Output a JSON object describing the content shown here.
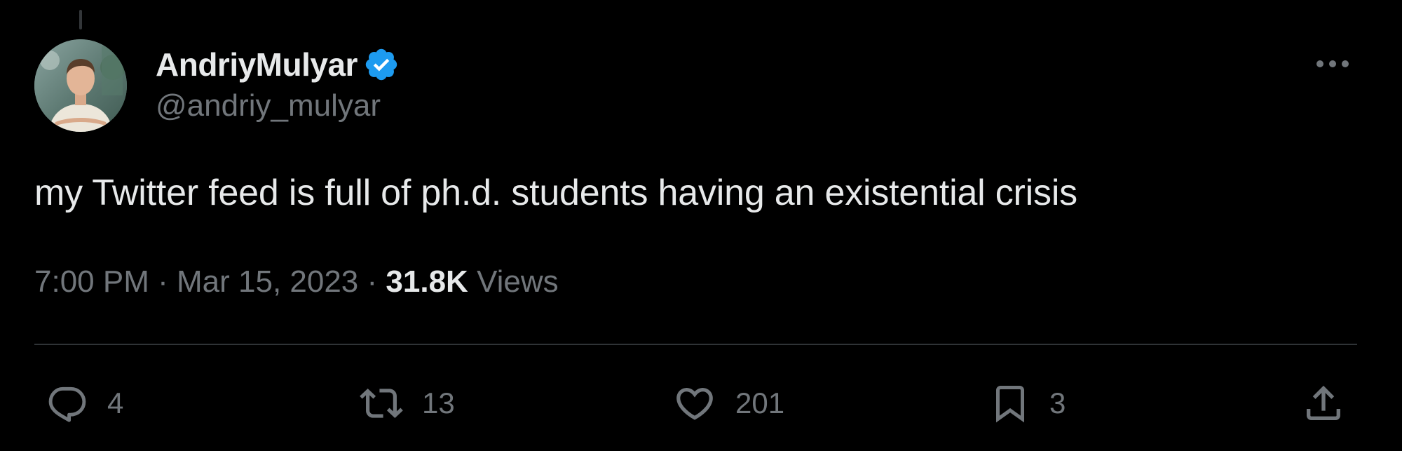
{
  "tweet": {
    "author": {
      "display_name": "AndriyMulyar",
      "handle": "@andriy_mulyar",
      "verified": true,
      "verified_color": "#1d9bf0"
    },
    "text": "my Twitter feed is full of ph.d. students having an existential crisis",
    "time": "7:00 PM",
    "date": "Mar 15, 2023",
    "separator": "·",
    "views_count": "31.8K",
    "views_label": "Views"
  },
  "actions": {
    "reply": {
      "icon": "reply-icon",
      "count": "4"
    },
    "retweet": {
      "icon": "retweet-icon",
      "count": "13"
    },
    "like": {
      "icon": "heart-icon",
      "count": "201"
    },
    "bookmark": {
      "icon": "bookmark-icon",
      "count": "3"
    },
    "share": {
      "icon": "share-icon"
    }
  },
  "colors": {
    "background": "#000000",
    "primary_text": "#e7e9ea",
    "secondary_text": "#71767b",
    "divider": "#2f3336",
    "accent": "#1d9bf0"
  }
}
